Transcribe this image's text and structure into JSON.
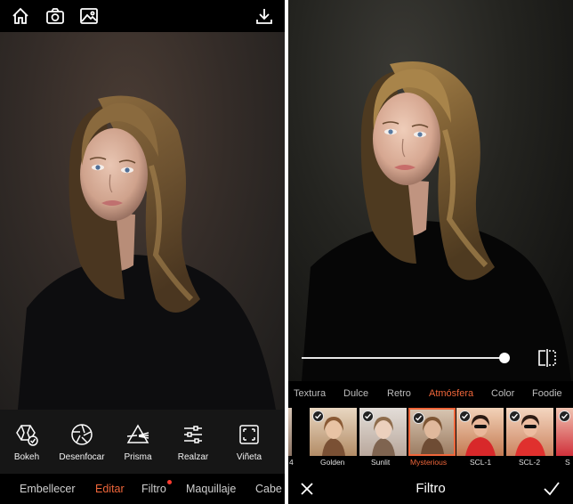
{
  "left": {
    "top_icons": [
      "home-icon",
      "camera-icon",
      "gallery-icon",
      "download-icon"
    ],
    "tools": [
      {
        "label": "Bokeh",
        "icon": "bokeh-icon"
      },
      {
        "label": "Desenfocar",
        "icon": "aperture-icon"
      },
      {
        "label": "Prisma",
        "icon": "prism-icon"
      },
      {
        "label": "Realzar",
        "icon": "sliders-icon"
      },
      {
        "label": "Viñeta",
        "icon": "vignette-icon"
      }
    ],
    "bottom_tabs": [
      "Embellecer",
      "Editar",
      "Filtro",
      "Maquillaje",
      "Cabe"
    ],
    "active_tab": "Editar",
    "notification_tab": "Filtro"
  },
  "right": {
    "slider_level": 0.98,
    "categories": [
      "Textura",
      "Dulce",
      "Retro",
      "Atmósfera",
      "Color",
      "Foodie"
    ],
    "active_category": "Atmósfera",
    "filters": [
      {
        "label": "4",
        "partial": true
      },
      {
        "label": "Golden",
        "checked": true
      },
      {
        "label": "Sunlit",
        "checked": true
      },
      {
        "label": "Mysterious",
        "checked": true,
        "selected": true
      },
      {
        "label": "SCL-1",
        "checked": true
      },
      {
        "label": "SCL-2",
        "checked": true
      },
      {
        "label": "S",
        "partial": true
      }
    ],
    "title": "Filtro",
    "close_icon": "close-icon",
    "confirm_icon": "checkmark-icon"
  },
  "colors": {
    "accent": "#f0663a",
    "notification": "#ff3b30",
    "background": "#000000",
    "toolbar": "#161616"
  }
}
